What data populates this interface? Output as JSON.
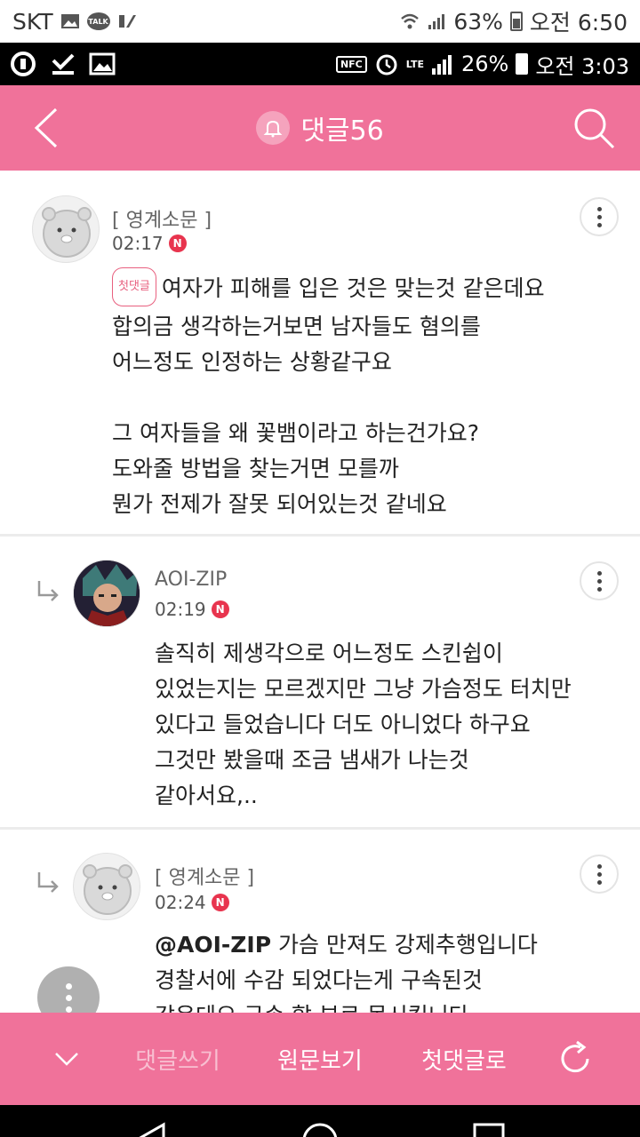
{
  "outer_status": {
    "carrier": "SKT",
    "talk_label": "TALK",
    "battery": "63%",
    "time": "오전 6:50"
  },
  "inner_status": {
    "nfc": "NFC",
    "lte": "LTE",
    "battery": "26%",
    "time": "오전 3:03"
  },
  "header": {
    "title": "댓글56"
  },
  "comments": [
    {
      "author": "[ 영계소문 ]",
      "time": "02:17",
      "badge": "N",
      "first_label": "첫댓글",
      "lines": [
        "여자가 피해를 입은 것은 맞는것 같은데요",
        "합의금 생각하는거보면 남자들도 혐의를",
        "어느정도 인정하는 상황같구요",
        "",
        "그 여자들을 왜 꽃뱀이라고 하는건가요?",
        "도와줄 방법을 찾는거면 모를까",
        "뭔가 전제가 잘못 되어있는것 같네요"
      ]
    },
    {
      "author": "AOI-ZIP",
      "time": "02:19",
      "badge": "N",
      "lines": [
        "솔직히 제생각으로 어느정도 스킨쉽이",
        "있었는지는 모르겠지만 그냥 가슴정도 터치만",
        "있다고 들었습니다 더도 아니었다 하구요",
        "그것만 봤을때 조금 냄새가 나는것",
        "같아서요,.."
      ]
    },
    {
      "author": "[ 영계소문 ]",
      "time": "02:24",
      "badge": "N",
      "mention": "@AOI-ZIP",
      "lines": [
        " 가슴 만져도 강제추행입니다",
        "경찰서에 수감 되었다는게 구속된것",
        "같은데요 구속 할 부로 못시킵니다"
      ]
    }
  ],
  "bottom_bar": {
    "write": "댓글쓰기",
    "original": "원문보기",
    "first": "첫댓글로"
  },
  "colors": {
    "accent": "#f0729a",
    "badge": "#e8344e"
  }
}
